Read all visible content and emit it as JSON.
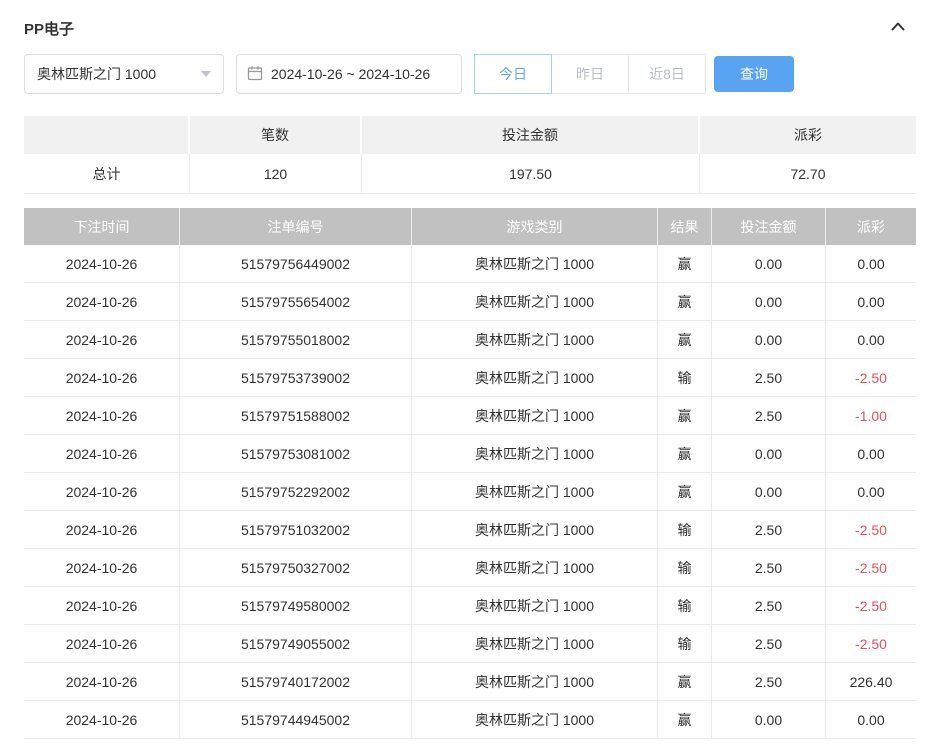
{
  "panel": {
    "title": "PP电子"
  },
  "icons": {
    "collapse": "chevron-up-icon",
    "select_caret": "caret-down-icon",
    "date": "calendar-icon"
  },
  "filters": {
    "game_select": {
      "value": "奥林匹斯之门 1000"
    },
    "date_range": {
      "value": "2024-10-26 ~ 2024-10-26"
    },
    "quick_buttons": [
      {
        "label": "今日",
        "active": true
      },
      {
        "label": "昨日",
        "active": false
      },
      {
        "label": "近8日",
        "active": false
      }
    ],
    "search_label": "查询"
  },
  "summary": {
    "headers": [
      "",
      "笔数",
      "投注金额",
      "派彩"
    ],
    "row": {
      "label": "总计",
      "count": "120",
      "bet_amount": "197.50",
      "payout": "72.70"
    }
  },
  "table": {
    "headers": [
      "下注时间",
      "注单编号",
      "游戏类别",
      "结果",
      "投注金额",
      "派彩"
    ],
    "rows": [
      {
        "time": "2024-10-26",
        "bet_id": "51579756449002",
        "game": "奥林匹斯之门 1000",
        "result": "赢",
        "amount": "0.00",
        "payout": "0.00"
      },
      {
        "time": "2024-10-26",
        "bet_id": "51579755654002",
        "game": "奥林匹斯之门 1000",
        "result": "赢",
        "amount": "0.00",
        "payout": "0.00"
      },
      {
        "time": "2024-10-26",
        "bet_id": "51579755018002",
        "game": "奥林匹斯之门 1000",
        "result": "赢",
        "amount": "0.00",
        "payout": "0.00"
      },
      {
        "time": "2024-10-26",
        "bet_id": "51579753739002",
        "game": "奥林匹斯之门 1000",
        "result": "输",
        "amount": "2.50",
        "payout": "-2.50"
      },
      {
        "time": "2024-10-26",
        "bet_id": "51579751588002",
        "game": "奥林匹斯之门 1000",
        "result": "赢",
        "amount": "2.50",
        "payout": "-1.00"
      },
      {
        "time": "2024-10-26",
        "bet_id": "51579753081002",
        "game": "奥林匹斯之门 1000",
        "result": "赢",
        "amount": "0.00",
        "payout": "0.00"
      },
      {
        "time": "2024-10-26",
        "bet_id": "51579752292002",
        "game": "奥林匹斯之门 1000",
        "result": "赢",
        "amount": "0.00",
        "payout": "0.00"
      },
      {
        "time": "2024-10-26",
        "bet_id": "51579751032002",
        "game": "奥林匹斯之门 1000",
        "result": "输",
        "amount": "2.50",
        "payout": "-2.50"
      },
      {
        "time": "2024-10-26",
        "bet_id": "51579750327002",
        "game": "奥林匹斯之门 1000",
        "result": "输",
        "amount": "2.50",
        "payout": "-2.50"
      },
      {
        "time": "2024-10-26",
        "bet_id": "51579749580002",
        "game": "奥林匹斯之门 1000",
        "result": "输",
        "amount": "2.50",
        "payout": "-2.50"
      },
      {
        "time": "2024-10-26",
        "bet_id": "51579749055002",
        "game": "奥林匹斯之门 1000",
        "result": "输",
        "amount": "2.50",
        "payout": "-2.50"
      },
      {
        "time": "2024-10-26",
        "bet_id": "51579740172002",
        "game": "奥林匹斯之门 1000",
        "result": "赢",
        "amount": "2.50",
        "payout": "226.40"
      },
      {
        "time": "2024-10-26",
        "bet_id": "51579744945002",
        "game": "奥林匹斯之门 1000",
        "result": "赢",
        "amount": "0.00",
        "payout": "0.00"
      }
    ]
  },
  "colors": {
    "accent": "#58a4f2",
    "negative": "#e8505b",
    "table_header_bg": "#c1c1c1",
    "summary_header_bg": "#f1f1f1"
  }
}
